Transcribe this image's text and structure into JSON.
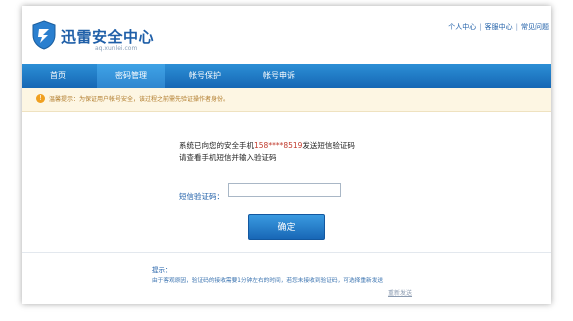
{
  "header": {
    "logo_title": "迅雷安全中心",
    "logo_sub": "aq.xunlei.com",
    "links": [
      "个人中心",
      "客服中心",
      "常见问题"
    ]
  },
  "nav": {
    "items": [
      "首页",
      "密码管理",
      "帐号保护",
      "帐号申诉"
    ],
    "active_index": 1
  },
  "notice": {
    "icon": "warning-icon",
    "text": "温馨提示：为保证用户帐号安全，该过程之前需先验证操作者身份。"
  },
  "main": {
    "message_prefix": "系统已向您的安全手机",
    "phone": "158****8519",
    "message_suffix": "发送短信验证码",
    "message_line2": "请查看手机短信并输入验证码",
    "sms_label": "短信验证码：",
    "sms_value": "",
    "confirm_label": "确定"
  },
  "tips": {
    "title": "提示：",
    "body": "由于客观原因，验证码的接收需要1分钟左右的时间，若您未接收到验证码，可选择重新发送",
    "resend_label": "重新发送"
  },
  "colors": {
    "brand": "#1f5fa8",
    "nav_bar": "#1a74c2",
    "phone_highlight": "#c0392b",
    "notice_bg": "#fdf6e3"
  }
}
